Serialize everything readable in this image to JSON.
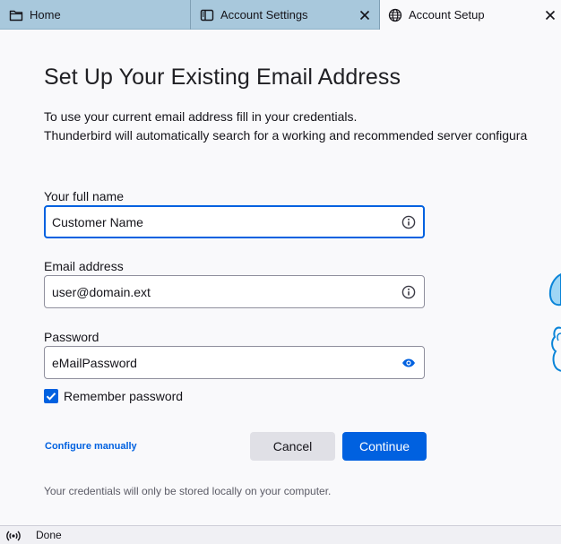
{
  "tabs": [
    {
      "label": "Home",
      "icon": "folder-icon"
    },
    {
      "label": "Account Settings",
      "icon": "settings-panel-icon"
    },
    {
      "label": "Account Setup",
      "icon": "globe-icon"
    }
  ],
  "setup": {
    "title": "Set Up Your Existing Email Address",
    "intro_line1": "To use your current email address fill in your credentials.",
    "intro_line2": "Thunderbird will automatically search for a working and recommended server configura",
    "fullname_label": "Your full name",
    "fullname_value": "Customer Name",
    "email_label": "Email address",
    "email_value": "user@domain.ext",
    "password_label": "Password",
    "password_value": "eMailPassword",
    "remember_label": "Remember password",
    "remember_checked": true,
    "configure_manually": "Configure manually",
    "cancel_label": "Cancel",
    "continue_label": "Continue",
    "note": "Your credentials will only be stored locally on your computer."
  },
  "status": {
    "text": "Done",
    "icon": "connection-status-icon"
  },
  "colors": {
    "accent": "#0061e0",
    "tabbar": "#a8c8dc",
    "background": "#f9f9fb"
  }
}
